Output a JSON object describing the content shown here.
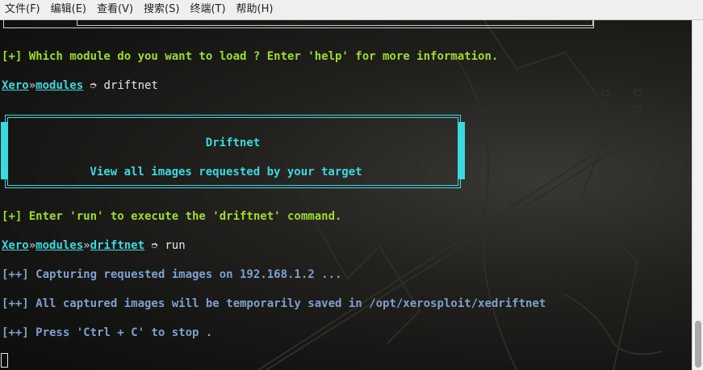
{
  "menu": {
    "items": [
      "文件(F)",
      "编辑(E)",
      "查看(V)",
      "搜索(S)",
      "终端(T)",
      "帮助(H)"
    ]
  },
  "terminal": {
    "question": "[+] Which module do you want to load ? Enter 'help' for more information.",
    "prompt1": {
      "user": "Xero",
      "sep": "»",
      "path": "modules",
      "arrow": " ➮ ",
      "command": "driftnet"
    },
    "banner": {
      "title": "Driftnet",
      "description": "View all images requested by your target"
    },
    "hint": "[+] Enter 'run' to execute the 'driftnet' command.",
    "prompt2": {
      "user": "Xero",
      "sep1": "»",
      "path": "modules",
      "sep2": "»",
      "module": "driftnet",
      "arrow": " ➮ ",
      "command": "run"
    },
    "output": [
      "[++] Capturing requested images on 192.168.1.2 ...",
      "[++] All captured images will be temporarily saved in /opt/xerosploit/xedriftnet",
      "[++] Press 'Ctrl + C' to stop ."
    ]
  },
  "colors": {
    "info": "#9edd2a",
    "prompt": "#3bd9e0",
    "output": "#7ea0cf",
    "background": "#141412"
  }
}
